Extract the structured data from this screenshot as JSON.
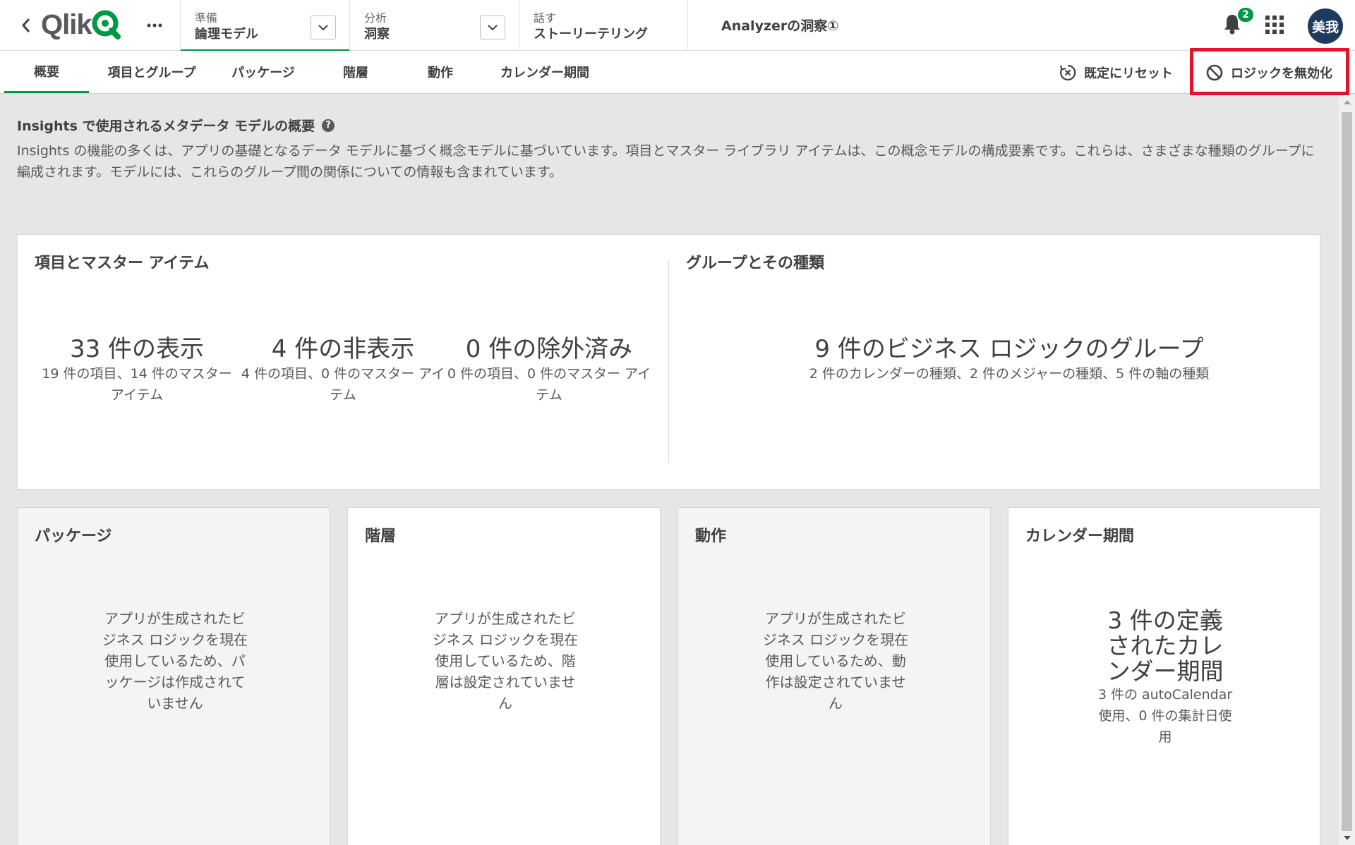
{
  "header": {
    "logo_text": "Qlik",
    "steps": [
      {
        "caption": "準備",
        "value": "論理モデル"
      },
      {
        "caption": "分析",
        "value": "洞察"
      },
      {
        "caption": "話す",
        "value": "ストーリーテリング"
      }
    ],
    "app_title": "Analyzerの洞察①",
    "notification_count": "2",
    "avatar_text": "美我"
  },
  "tabs": [
    "概要",
    "項目とグループ",
    "パッケージ",
    "階層",
    "動作",
    "カレンダー期間"
  ],
  "actions": {
    "reset_label": "既定にリセット",
    "disable_label": "ロジックを無効化"
  },
  "overview": {
    "title": "Insights で使用されるメタデータ モデルの概要",
    "help": "?",
    "description": "Insights の機能の多くは、アプリの基礎となるデータ モデルに基づく概念モデルに基づいています。項目とマスター ライブラリ アイテムは、この概念モデルの構成要素です。これらは、さまざまな種類のグループに編成されます。モデルには、これらのグループ間の関係についての情報も含まれています。"
  },
  "items_card": {
    "title": "項目とマスター アイテム",
    "kpis": [
      {
        "big": "33 件の表示",
        "small": "19 件の項目、14 件のマスター アイテム"
      },
      {
        "big": "4 件の非表示",
        "small": "4 件の項目、0 件のマスター アイテム"
      },
      {
        "big": "0 件の除外済み",
        "small": "0 件の項目、0 件のマスター アイテム"
      }
    ]
  },
  "groups_card": {
    "title": "グループとその種類",
    "big": "9 件のビジネス ロジックのグループ",
    "small": "2 件のカレンダーの種類、2 件のメジャーの種類、5 件の軸の種類"
  },
  "bottom_cards": [
    {
      "title": "パッケージ",
      "text": "アプリが生成されたビジネス ロジックを現在使用しているため、パッケージは作成されていません"
    },
    {
      "title": "階層",
      "text": "アプリが生成されたビジネス ロジックを現在使用しているため、階層は設定されていません"
    },
    {
      "title": "動作",
      "text": "アプリが生成されたビジネス ロジックを現在使用しているため、動作は設定されていません"
    },
    {
      "title": "カレンダー期間",
      "big": "3 件の定義されたカレンダー期間",
      "small": "3 件の autoCalendar 使用、0 件の集計日使用"
    }
  ],
  "colors": {
    "accent": "#009845",
    "highlight": "#e8112d",
    "avatar": "#1e3a5f"
  }
}
